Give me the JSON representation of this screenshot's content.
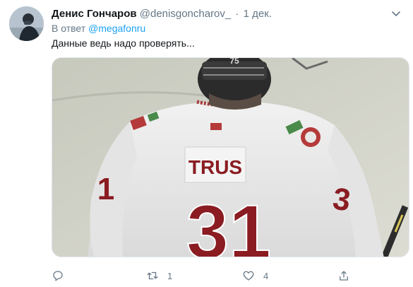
{
  "tweet": {
    "author_name": "Денис Гончаров",
    "author_handle": "@denisgoncharov_",
    "separator": "·",
    "date": "1 дек.",
    "reply_prefix": "В ответ",
    "reply_to": "@megafonru",
    "text": "Данные ведь надо проверять..."
  },
  "media": {
    "jersey_name": "TRUS",
    "jersey_number": "31",
    "helmet_number": "75"
  },
  "actions": {
    "reply_count": "",
    "retweet_count": "1",
    "like_count": "4"
  },
  "icons": {
    "reply": "comment-icon",
    "retweet": "retweet-icon",
    "like": "heart-icon",
    "share": "share-icon",
    "more": "chevron-down-icon"
  },
  "colors": {
    "link": "#1da1f2",
    "muted": "#657786",
    "jersey_red": "#8a1c22"
  }
}
